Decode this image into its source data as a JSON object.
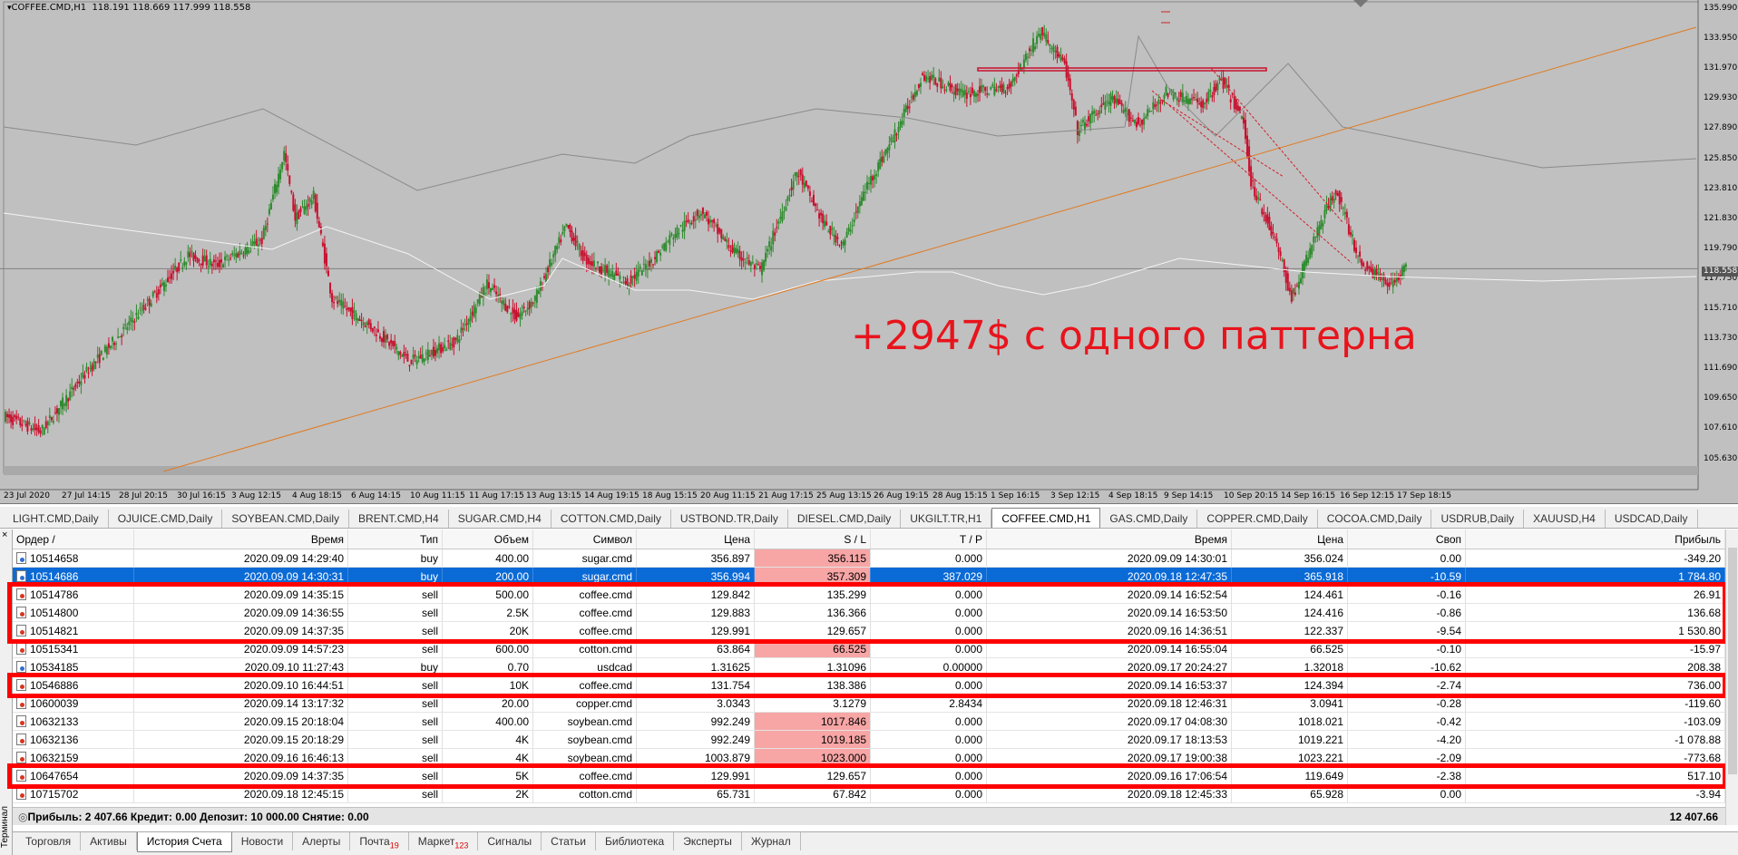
{
  "chart": {
    "title": "COFFEE.CMD,H1",
    "ohlc": "118.191 118.669 117.999 118.558",
    "current_price": "118.558",
    "overlay_text": "+2947$ с одного паттерна",
    "price_labels": [
      "135.990",
      "133.950",
      "131.970",
      "129.930",
      "127.890",
      "125.850",
      "123.810",
      "121.830",
      "119.790",
      "117.750",
      "115.710",
      "113.730",
      "111.690",
      "109.650",
      "107.610",
      "105.630"
    ],
    "time_labels": [
      "23 Jul 2020",
      "27 Jul 14:15",
      "28 Jul 20:15",
      "30 Jul 16:15",
      "3 Aug 12:15",
      "4 Aug 18:15",
      "6 Aug 14:15",
      "10 Aug 11:15",
      "11 Aug 17:15",
      "13 Aug 13:15",
      "14 Aug 19:15",
      "18 Aug 15:15",
      "20 Aug 11:15",
      "21 Aug 17:15",
      "25 Aug 13:15",
      "26 Aug 19:15",
      "28 Aug 15:15",
      "1 Sep 16:15",
      "3 Sep 12:15",
      "4 Sep 18:15",
      "9 Sep 14:15",
      "10 Sep 20:15",
      "14 Sep 16:15",
      "16 Sep 12:15",
      "17 Sep 18:15"
    ],
    "colors": {
      "background": "#c0c0c0",
      "bull": "#2e8b2e",
      "bear": "#c8102e",
      "trend": "#e07a20",
      "overlay": "#e8141c"
    }
  },
  "chart_tabs": [
    "LIGHT.CMD,Daily",
    "OJUICE.CMD,Daily",
    "SOYBEAN.CMD,Daily",
    "BRENT.CMD,H4",
    "SUGAR.CMD,H4",
    "COTTON.CMD,Daily",
    "USTBOND.TR,Daily",
    "DIESEL.CMD,Daily",
    "UKGILT.TR,H1",
    "COFFEE.CMD,H1",
    "GAS.CMD,Daily",
    "COPPER.CMD,Daily",
    "COCOA.CMD,Daily",
    "USDRUB,Daily",
    "XAUUSD,H4",
    "USDCAD,Daily"
  ],
  "active_chart_tab": 9,
  "terminal": {
    "side_label": "Терминал",
    "close": "×",
    "columns": [
      "Ордер",
      "Время",
      "Тип",
      "Объем",
      "Символ",
      "Цена",
      "S / L",
      "T / P",
      "Время",
      "Цена",
      "Своп",
      "Прибыль"
    ],
    "sort_indicator": "/",
    "rows": [
      {
        "order": "10514658",
        "time_open": "2020.09.09 14:29:40",
        "type": "buy",
        "volume": "400.00",
        "symbol": "sugar.cmd",
        "price_open": "356.897",
        "sl": "356.115",
        "tp": "0.000",
        "time_close": "2020.09.09 14:30:01",
        "price_close": "356.024",
        "swap": "0.00",
        "profit": "-349.20",
        "sl_red": true,
        "selected": false,
        "hl": false
      },
      {
        "order": "10514686",
        "time_open": "2020.09.09 14:30:31",
        "type": "buy",
        "volume": "200.00",
        "symbol": "sugar.cmd",
        "price_open": "356.994",
        "sl": "357.309",
        "tp": "387.029",
        "time_close": "2020.09.18 12:47:35",
        "price_close": "365.918",
        "swap": "-10.59",
        "profit": "1 784.80",
        "sl_red": true,
        "selected": true,
        "hl": false
      },
      {
        "order": "10514786",
        "time_open": "2020.09.09 14:35:15",
        "type": "sell",
        "volume": "500.00",
        "symbol": "coffee.cmd",
        "price_open": "129.842",
        "sl": "135.299",
        "tp": "0.000",
        "time_close": "2020.09.14 16:52:54",
        "price_close": "124.461",
        "swap": "-0.16",
        "profit": "26.91",
        "sl_red": false,
        "selected": false,
        "hl": true
      },
      {
        "order": "10514800",
        "time_open": "2020.09.09 14:36:55",
        "type": "sell",
        "volume": "2.5K",
        "symbol": "coffee.cmd",
        "price_open": "129.883",
        "sl": "136.366",
        "tp": "0.000",
        "time_close": "2020.09.14 16:53:50",
        "price_close": "124.416",
        "swap": "-0.86",
        "profit": "136.68",
        "sl_red": false,
        "selected": false,
        "hl": true
      },
      {
        "order": "10514821",
        "time_open": "2020.09.09 14:37:35",
        "type": "sell",
        "volume": "20K",
        "symbol": "coffee.cmd",
        "price_open": "129.991",
        "sl": "129.657",
        "tp": "0.000",
        "time_close": "2020.09.16 14:36:51",
        "price_close": "122.337",
        "swap": "-9.54",
        "profit": "1 530.80",
        "sl_red": false,
        "selected": false,
        "hl": true
      },
      {
        "order": "10515341",
        "time_open": "2020.09.09 14:57:23",
        "type": "sell",
        "volume": "600.00",
        "symbol": "cotton.cmd",
        "price_open": "63.864",
        "sl": "66.525",
        "tp": "0.000",
        "time_close": "2020.09.14 16:55:04",
        "price_close": "66.525",
        "swap": "-0.10",
        "profit": "-15.97",
        "sl_red": true,
        "selected": false,
        "hl": false
      },
      {
        "order": "10534185",
        "time_open": "2020.09.10 11:27:43",
        "type": "buy",
        "volume": "0.70",
        "symbol": "usdcad",
        "price_open": "1.31625",
        "sl": "1.31096",
        "tp": "0.00000",
        "time_close": "2020.09.17 20:24:27",
        "price_close": "1.32018",
        "swap": "-10.62",
        "profit": "208.38",
        "sl_red": false,
        "selected": false,
        "hl": false
      },
      {
        "order": "10546886",
        "time_open": "2020.09.10 16:44:51",
        "type": "sell",
        "volume": "10K",
        "symbol": "coffee.cmd",
        "price_open": "131.754",
        "sl": "138.386",
        "tp": "0.000",
        "time_close": "2020.09.14 16:53:37",
        "price_close": "124.394",
        "swap": "-2.74",
        "profit": "736.00",
        "sl_red": false,
        "selected": false,
        "hl": true
      },
      {
        "order": "10600039",
        "time_open": "2020.09.14 13:17:32",
        "type": "sell",
        "volume": "20.00",
        "symbol": "copper.cmd",
        "price_open": "3.0343",
        "sl": "3.1279",
        "tp": "2.8434",
        "time_close": "2020.09.18 12:46:31",
        "price_close": "3.0941",
        "swap": "-0.28",
        "profit": "-119.60",
        "sl_red": false,
        "selected": false,
        "hl": false
      },
      {
        "order": "10632133",
        "time_open": "2020.09.15 20:18:04",
        "type": "sell",
        "volume": "400.00",
        "symbol": "soybean.cmd",
        "price_open": "992.249",
        "sl": "1017.846",
        "tp": "0.000",
        "time_close": "2020.09.17 04:08:30",
        "price_close": "1018.021",
        "swap": "-0.42",
        "profit": "-103.09",
        "sl_red": true,
        "selected": false,
        "hl": false
      },
      {
        "order": "10632136",
        "time_open": "2020.09.15 20:18:29",
        "type": "sell",
        "volume": "4K",
        "symbol": "soybean.cmd",
        "price_open": "992.249",
        "sl": "1019.185",
        "tp": "0.000",
        "time_close": "2020.09.17 18:13:53",
        "price_close": "1019.221",
        "swap": "-4.20",
        "profit": "-1 078.88",
        "sl_red": true,
        "selected": false,
        "hl": false
      },
      {
        "order": "10632159",
        "time_open": "2020.09.16 16:46:13",
        "type": "sell",
        "volume": "4K",
        "symbol": "soybean.cmd",
        "price_open": "1003.879",
        "sl": "1023.000",
        "tp": "0.000",
        "time_close": "2020.09.17 19:00:38",
        "price_close": "1023.221",
        "swap": "-2.09",
        "profit": "-773.68",
        "sl_red": true,
        "selected": false,
        "hl": false
      },
      {
        "order": "10647654",
        "time_open": "2020.09.09 14:37:35",
        "type": "sell",
        "volume": "5K",
        "symbol": "coffee.cmd",
        "price_open": "129.991",
        "sl": "129.657",
        "tp": "0.000",
        "time_close": "2020.09.16 17:06:54",
        "price_close": "119.649",
        "swap": "-2.38",
        "profit": "517.10",
        "sl_red": false,
        "selected": false,
        "hl": true
      },
      {
        "order": "10715702",
        "time_open": "2020.09.18 12:45:15",
        "type": "sell",
        "volume": "2K",
        "symbol": "cotton.cmd",
        "price_open": "65.731",
        "sl": "67.842",
        "tp": "0.000",
        "time_close": "2020.09.18 12:45:33",
        "price_close": "65.928",
        "swap": "0.00",
        "profit": "-3.94",
        "sl_red": false,
        "selected": false,
        "hl": false
      }
    ],
    "summary": "Прибыль: 2 407.66  Кредит: 0.00  Депозит: 10 000.00  Снятие: 0.00",
    "summary_total": "12 407.66"
  },
  "bottom_tabs": [
    {
      "label": "Торговля"
    },
    {
      "label": "Активы"
    },
    {
      "label": "История Счета"
    },
    {
      "label": "Новости"
    },
    {
      "label": "Алерты"
    },
    {
      "label": "Почта",
      "badge": "19"
    },
    {
      "label": "Маркет",
      "badge": "123"
    },
    {
      "label": "Сигналы"
    },
    {
      "label": "Статьи"
    },
    {
      "label": "Библиотека"
    },
    {
      "label": "Эксперты"
    },
    {
      "label": "Журнал"
    }
  ],
  "active_bottom_tab": 2
}
